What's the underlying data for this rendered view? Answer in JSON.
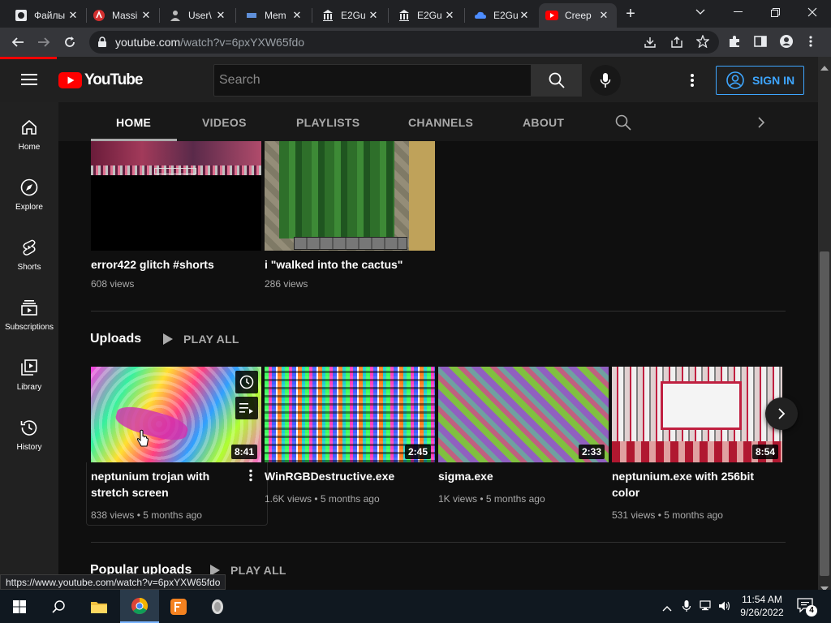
{
  "browser": {
    "tabs": [
      {
        "title": "Файлы",
        "icon": "file-icon"
      },
      {
        "title": "Massi",
        "icon": "red-shield-icon"
      },
      {
        "title": "User\\",
        "icon": "user-icon"
      },
      {
        "title": "Mem",
        "icon": "memory-icon"
      },
      {
        "title": "E2Gu",
        "icon": "building-icon"
      },
      {
        "title": "E2Gu",
        "icon": "building-icon"
      },
      {
        "title": "E2Gu",
        "icon": "cloud-icon"
      },
      {
        "title": "Creep",
        "icon": "youtube-icon"
      }
    ],
    "url_host": "youtube.com",
    "url_path": "/watch?v=6pxYXW65fdo",
    "status_url": "https://www.youtube.com/watch?v=6pxYXW65fdo"
  },
  "youtube": {
    "logo_text": "YouTube",
    "search_placeholder": "Search",
    "sign_in_label": "SIGN IN",
    "sidebar": [
      {
        "label": "Home",
        "icon": "home-icon"
      },
      {
        "label": "Explore",
        "icon": "compass-icon"
      },
      {
        "label": "Shorts",
        "icon": "shorts-icon"
      },
      {
        "label": "Subscriptions",
        "icon": "subscriptions-icon"
      },
      {
        "label": "Library",
        "icon": "library-icon"
      },
      {
        "label": "History",
        "icon": "history-icon"
      }
    ],
    "channel_tabs": [
      "HOME",
      "VIDEOS",
      "PLAYLISTS",
      "CHANNELS",
      "ABOUT"
    ],
    "shorts": [
      {
        "title": "error422 glitch #shorts",
        "meta": "608 views"
      },
      {
        "title": "i \"walked into the cactus\"",
        "meta": "286 views"
      }
    ],
    "uploads": {
      "heading": "Uploads",
      "play_all": "PLAY ALL",
      "videos": [
        {
          "title": "neptunium trojan with stretch screen",
          "views": "838 views",
          "age": "5 months ago",
          "duration": "8:41"
        },
        {
          "title": "WinRGBDestructive.exe",
          "views": "1.6K views",
          "age": "5 months ago",
          "duration": "2:45"
        },
        {
          "title": "sigma.exe",
          "views": "1K views",
          "age": "5 months ago",
          "duration": "2:33"
        },
        {
          "title": "neptunium.exe with 256bit color",
          "views": "531 views",
          "age": "5 months ago",
          "duration": "8:54"
        }
      ]
    },
    "popular": {
      "heading": "Popular uploads",
      "play_all": "PLAY ALL"
    }
  },
  "taskbar": {
    "time": "11:54 AM",
    "date": "9/26/2022",
    "notifications": "4"
  }
}
